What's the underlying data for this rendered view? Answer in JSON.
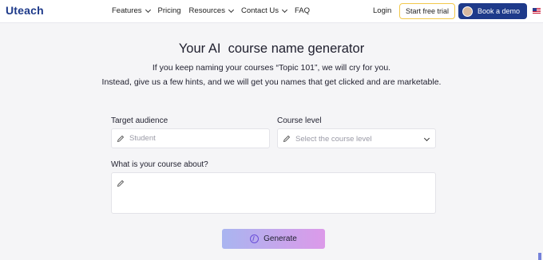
{
  "brand": {
    "name": "Uteach",
    "color": "#1e3a8a"
  },
  "nav": {
    "items": [
      {
        "label": "Features",
        "dropdown": true
      },
      {
        "label": "Pricing",
        "dropdown": false
      },
      {
        "label": "Resources",
        "dropdown": true
      },
      {
        "label": "Contact Us",
        "dropdown": true
      },
      {
        "label": "FAQ",
        "dropdown": false
      }
    ],
    "login_label": "Login",
    "trial_label": "Start free trial",
    "demo_label": "Book a demo",
    "language_icon": "us-flag-icon"
  },
  "hero": {
    "title": "Your AI  course name generator",
    "subtitle_line1": "If you keep naming your courses “Topic 101”, we will cry for you.",
    "subtitle_line2": "Instead, give us a few hints, and we will get you names that get clicked and are marketable."
  },
  "form": {
    "audience": {
      "label": "Target audience",
      "placeholder": "Student",
      "value": ""
    },
    "level": {
      "label": "Course level",
      "placeholder": "Select the course level",
      "value": ""
    },
    "about": {
      "label": "What is your course about?",
      "value": ""
    },
    "generate_label": "Generate"
  },
  "colors": {
    "accent": "#1e3a8a",
    "trial_border": "#f2c94c",
    "generate_gradient_start": "#a9b5f0",
    "generate_gradient_end": "#dc9ae9"
  }
}
